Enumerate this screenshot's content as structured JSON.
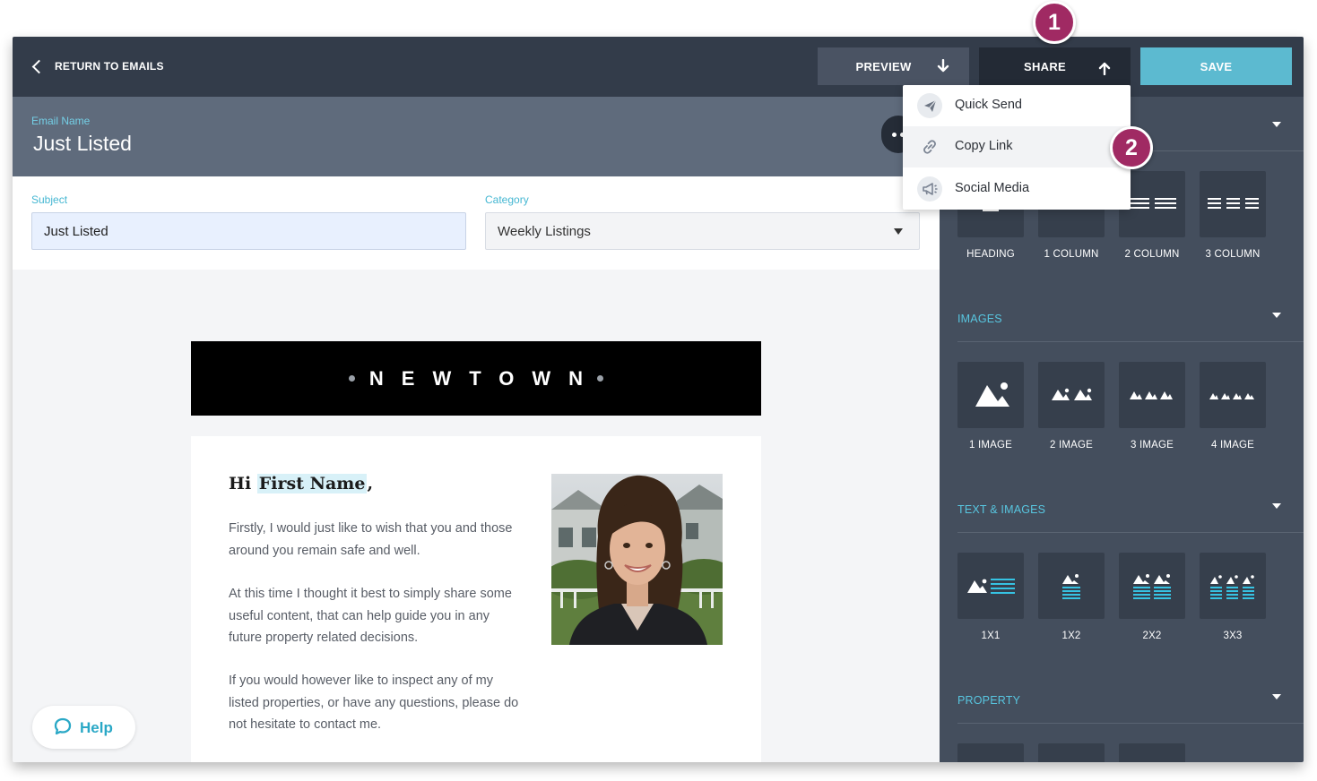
{
  "topbar": {
    "back_label": "RETURN TO EMAILS",
    "preview_label": "PREVIEW",
    "share_label": "SHARE",
    "save_label": "SAVE"
  },
  "email": {
    "name_label": "Email Name",
    "name_value": "Just Listed"
  },
  "fields": {
    "subject_label": "Subject",
    "subject_value": "Just Listed",
    "category_label": "Category",
    "category_value": "Weekly Listings"
  },
  "share_menu": {
    "items": [
      {
        "label": "Quick Send",
        "icon": "paper-plane-icon"
      },
      {
        "label": "Copy Link",
        "icon": "link-icon"
      },
      {
        "label": "Social Media",
        "icon": "megaphone-icon"
      }
    ]
  },
  "callouts": [
    "1",
    "2"
  ],
  "canvas": {
    "banner_text": "NEWTOWN",
    "greeting_prefix": "Hi ",
    "greeting_token": "First Name",
    "greeting_suffix": ",",
    "paragraphs": [
      "Firstly, I would just like to wish that you and those around you remain safe and well.",
      "At this time I thought it best to simply share some useful content, that can help guide you in any future property related decisions.",
      "If you would however like to inspect any of my listed properties, or have any questions, please do not hesitate to contact me."
    ]
  },
  "help": {
    "label": "Help"
  },
  "panel": {
    "layout_tiles": [
      "HEADING",
      "1 COLUMN",
      "2 COLUMN",
      "3 COLUMN"
    ],
    "images_title": "IMAGES",
    "image_tiles": [
      "1 IMAGE",
      "2 IMAGE",
      "3 IMAGE",
      "4 IMAGE"
    ],
    "text_images_title": "TEXT & IMAGES",
    "text_image_tiles": [
      "1X1",
      "1X2",
      "2X2",
      "3X3"
    ],
    "property_title": "PROPERTY"
  },
  "colors": {
    "topbar": "#333c4a",
    "accent": "#5cbad0",
    "panel": "#444e5d",
    "badge": "#a02a63"
  }
}
